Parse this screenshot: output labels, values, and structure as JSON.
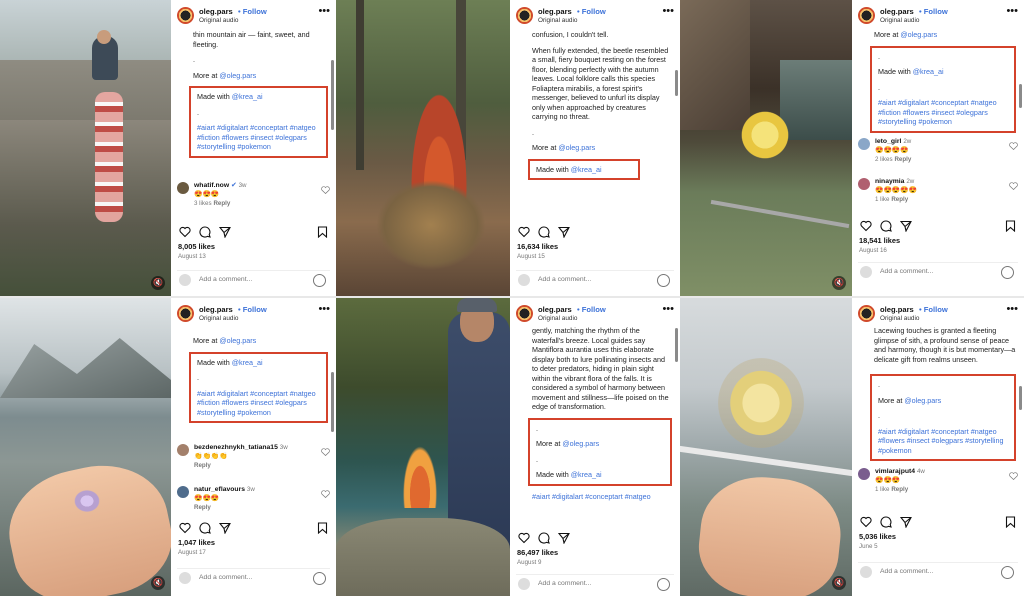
{
  "posts": [
    {
      "username": "oleg.pars",
      "follow": "• Follow",
      "audio": "Original audio",
      "caption_lines": [
        "thin mountain air — faint, sweet, and fleeting.",
        "."
      ],
      "more_at": "More at",
      "more_handle": "@oleg.pars",
      "made_with": "Made with",
      "made_handle": "@krea_ai",
      "dot": ".",
      "tags": "#aiart #digitalart #conceptart #natgeo #fiction #flowers #insect #olegpars #storytelling #pokemon",
      "comments": [
        {
          "user": "whatif.now",
          "time": "3w",
          "text": "😍😍😍",
          "likes": "3 likes",
          "reply": "Reply"
        }
      ],
      "likes": "8,005 likes",
      "date": "August 13",
      "add_comment": "Add a comment..."
    },
    {
      "username": "oleg.pars",
      "follow": "• Follow",
      "audio": "Original audio",
      "caption_lines": [
        "confusion, I couldn't tell.",
        "When fully extended, the beetle resembled a small, fiery bouquet resting on the forest floor, blending perfectly with the autumn leaves. Local folklore calls this species Foliaptera mirabilis, a forest spirit's messenger, believed to unfurl its display only when approached by creatures carrying no threat.",
        "."
      ],
      "more_at": "More at",
      "more_handle": "@oleg.pars",
      "made_with": "Made with",
      "made_handle": "@krea_ai",
      "likes": "16,634 likes",
      "date": "August 15",
      "add_comment": "Add a comment..."
    },
    {
      "username": "oleg.pars",
      "follow": "• Follow",
      "audio": "Original audio",
      "more_at": "More at",
      "more_handle": "@oleg.pars",
      "made_with": "Made with",
      "made_handle": "@krea_ai",
      "dot": ".",
      "tags": "#aiart #digitalart #conceptart #natgeo #fiction #flowers #insect #olegpars #storytelling #pokemon",
      "comments": [
        {
          "user": "leto_girl",
          "time": "2w",
          "text": "😍😍😍😍",
          "likes": "2 likes",
          "reply": "Reply"
        },
        {
          "user": "ninaymia",
          "time": "2w",
          "text": "😍😍😍😍😍",
          "likes": "1 like",
          "reply": "Reply"
        }
      ],
      "likes": "18,541 likes",
      "date": "August 16",
      "add_comment": "Add a comment..."
    },
    {
      "username": "oleg.pars",
      "follow": "• Follow",
      "audio": "Original audio",
      "more_at": "More at",
      "more_handle": "@oleg.pars",
      "made_with": "Made with",
      "made_handle": "@krea_ai",
      "dot": ".",
      "tags": "#aiart #digitalart #conceptart #natgeo #fiction #flowers #insect #olegpars #storytelling #pokemon",
      "comments": [
        {
          "user": "bezdenezhnykh_tatiana15",
          "time": "3w",
          "text": "👏👏👏👏",
          "likes": "",
          "reply": "Reply"
        },
        {
          "user": "natur_eflavours",
          "time": "3w",
          "text": "😍😍😍",
          "likes": "",
          "reply": "Reply"
        }
      ],
      "likes": "1,047 likes",
      "date": "August 17",
      "add_comment": "Add a comment..."
    },
    {
      "username": "oleg.pars",
      "follow": "• Follow",
      "audio": "Original audio",
      "caption_lines": [
        "gently, matching the rhythm of the waterfall's breeze. Local guides say Mantiflora aurantia uses this elaborate display both to lure pollinating insects and to deter predators, hiding in plain sight within the vibrant flora of the falls. It is considered a symbol of harmony between movement and stillness—life poised on the edge of transformation."
      ],
      "more_at": "More at",
      "more_handle": "@oleg.pars",
      "made_with": "Made with",
      "made_handle": "@krea_ai",
      "dot": ".",
      "tags": "#aiart #digitalart #conceptart #natgeo",
      "likes": "86,497 likes",
      "date": "August 9",
      "add_comment": "Add a comment..."
    },
    {
      "username": "oleg.pars",
      "follow": "• Follow",
      "audio": "Original audio",
      "caption_lines": [
        "Lacewing touches is granted a fleeting glimpse of sith, a profound sense of peace and harmony, though it is but momentary—a delicate gift from realms unseen."
      ],
      "more_at": "More at",
      "more_handle": "@oleg.pars",
      "dot": ".",
      "tags": "#aiart #digitalart #conceptart #natgeo #flowers #insect #olegpars #storytelling #pokemon",
      "comments": [
        {
          "user": "vimlarajput4",
          "time": "4w",
          "text": "😍😍😍",
          "likes": "1 like",
          "reply": "Reply"
        }
      ],
      "likes": "5,036 likes",
      "date": "June 5",
      "add_comment": "Add a comment..."
    }
  ]
}
